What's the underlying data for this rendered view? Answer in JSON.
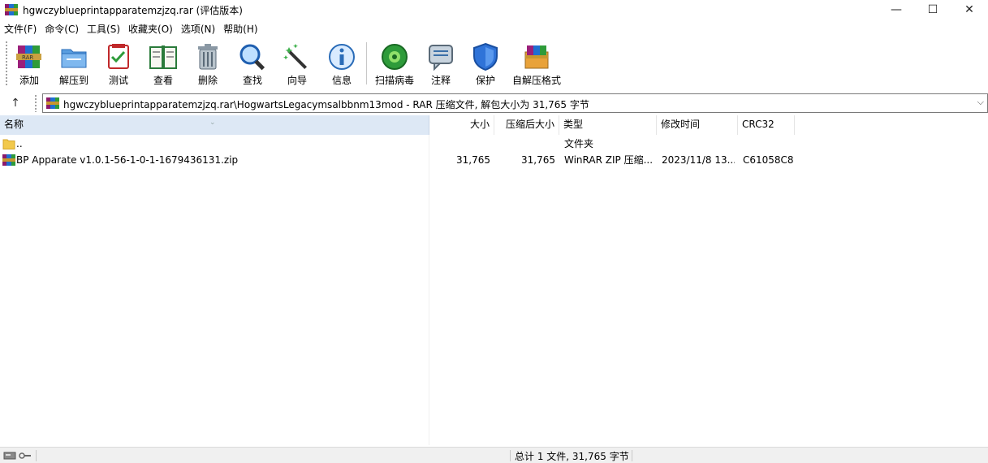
{
  "window": {
    "title": "hgwczyblueprintapparatemzjzq.rar (评估版本)",
    "minimize_glyph": "—",
    "maximize_glyph": "☐",
    "close_glyph": "✕"
  },
  "menu": [
    "文件(F)",
    "命令(C)",
    "工具(S)",
    "收藏夹(O)",
    "选项(N)",
    "帮助(H)"
  ],
  "toolbar": {
    "buttons": [
      {
        "label": "添加",
        "icon": "add-archive-icon"
      },
      {
        "label": "解压到",
        "icon": "extract-to-icon"
      },
      {
        "label": "测试",
        "icon": "test-icon"
      },
      {
        "label": "查看",
        "icon": "view-icon"
      },
      {
        "label": "删除",
        "icon": "delete-icon"
      },
      {
        "label": "查找",
        "icon": "find-icon"
      },
      {
        "label": "向导",
        "icon": "wizard-icon"
      },
      {
        "label": "信息",
        "icon": "info-icon"
      },
      {
        "label": "扫描病毒",
        "icon": "virus-scan-icon"
      },
      {
        "label": "注释",
        "icon": "comment-icon"
      },
      {
        "label": "保护",
        "icon": "protect-icon"
      },
      {
        "label": "自解压格式",
        "icon": "sfx-icon"
      }
    ]
  },
  "address": {
    "up_glyph": "↑",
    "path": "hgwczyblueprintapparatemzjzq.rar\\HogwartsLegacymsalbbnm13mod - RAR 压缩文件, 解包大小为 31,765 字节",
    "dropdown_glyph": "⌵"
  },
  "columns": {
    "name": "名称",
    "size": "大小",
    "packed": "压缩后大小",
    "type": "类型",
    "modified": "修改时间",
    "crc": "CRC32"
  },
  "rows": [
    {
      "name": "..",
      "size": "",
      "packed": "",
      "type": "文件夹",
      "modified": "",
      "crc": "",
      "icon": "folder-icon"
    },
    {
      "name": "BP Apparate v1.0.1-56-1-0-1-1679436131.zip",
      "size": "31,765",
      "packed": "31,765",
      "type": "WinRAR ZIP 压缩...",
      "modified": "2023/11/8 13...",
      "crc": "C61058C8",
      "icon": "zip-archive-icon"
    }
  ],
  "status": {
    "summary": "总计 1 文件, 31,765 字节"
  },
  "colors": {
    "header_selected": "#dde8f5",
    "statusbar": "#f0f0f0"
  }
}
